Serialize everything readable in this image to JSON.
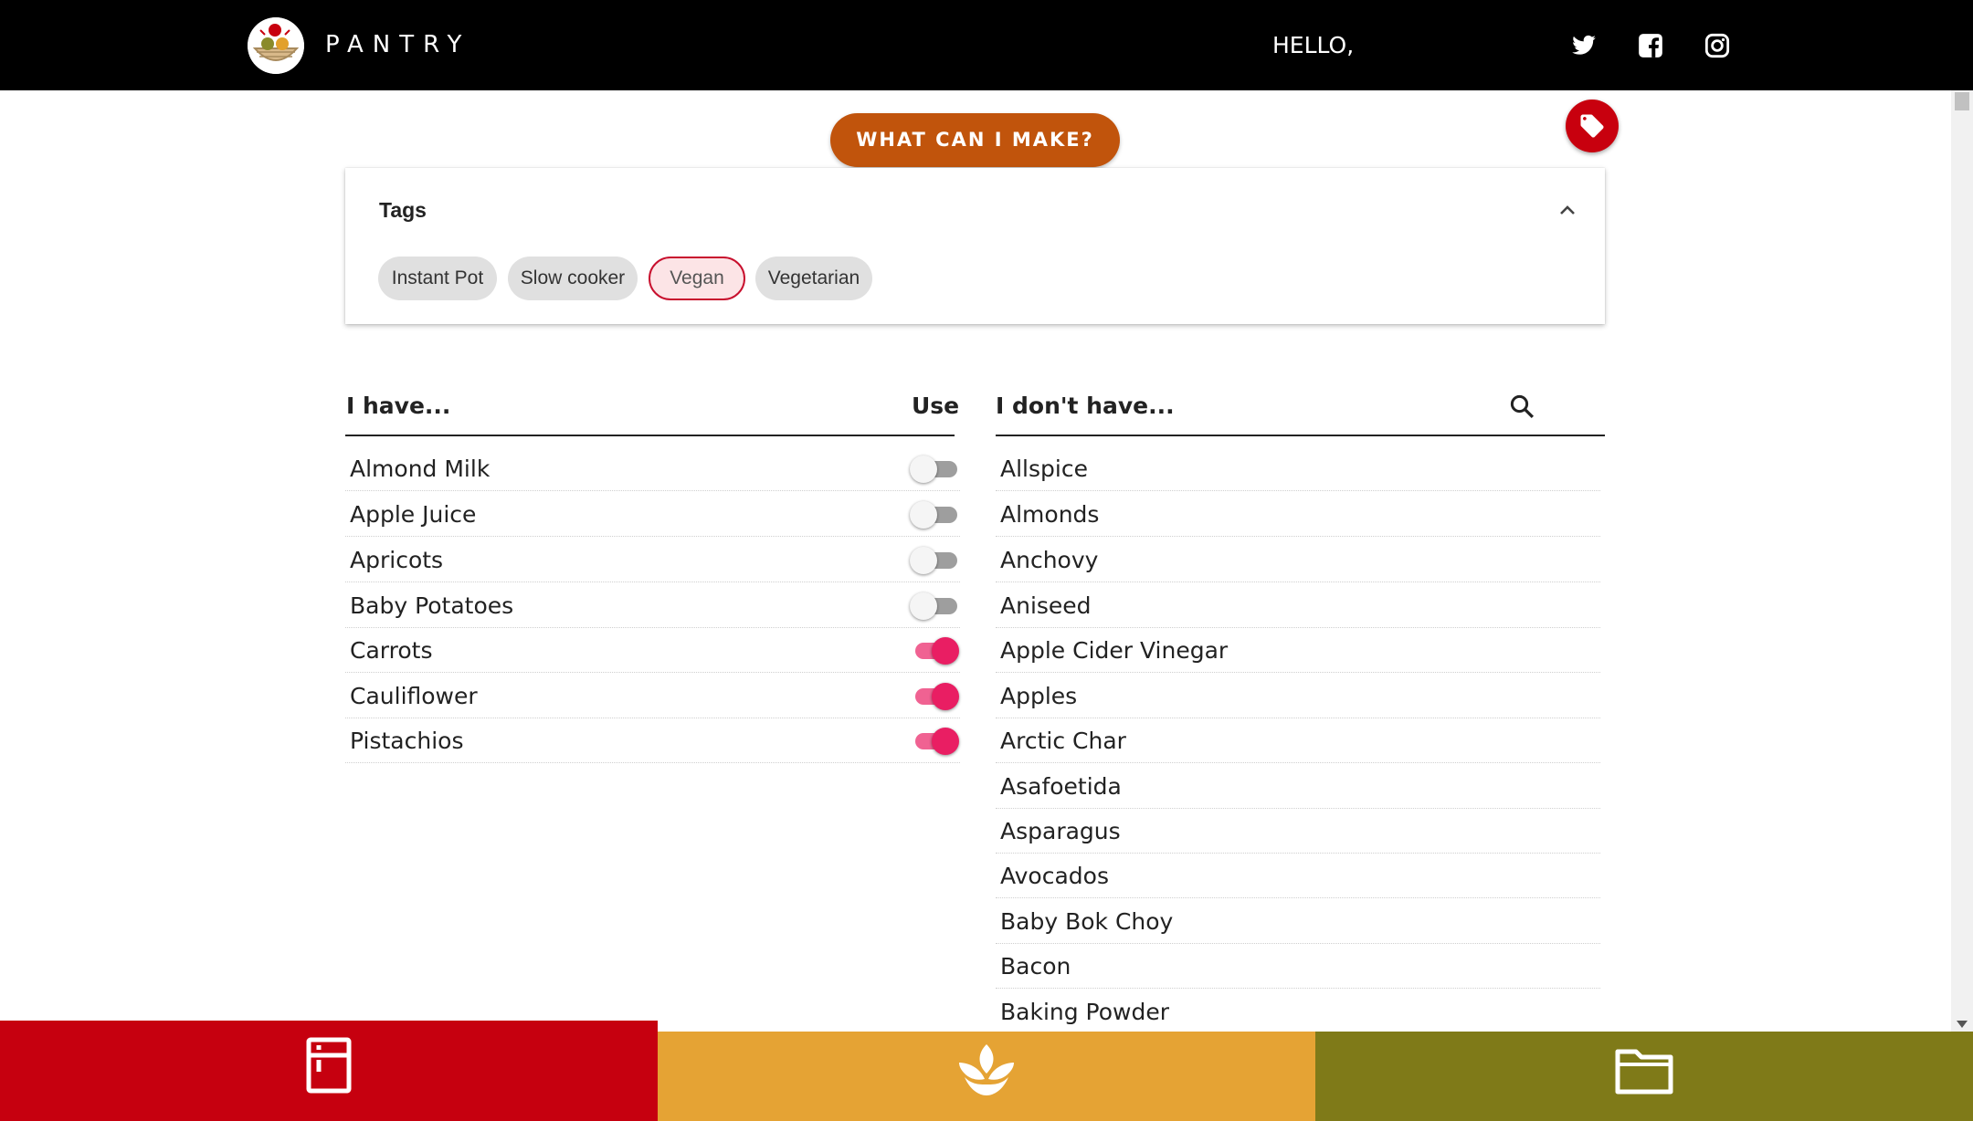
{
  "header": {
    "brand": "PANTRY",
    "greeting": "HELLO,",
    "social": [
      "twitter-icon",
      "facebook-icon",
      "instagram-icon"
    ],
    "colors": {
      "bar": "#000000"
    }
  },
  "actions": {
    "make_label": "WHAT CAN I MAKE?",
    "make_color": "#c1540c",
    "tag_button_icon": "tag-icon",
    "tag_button_color": "#c8000e"
  },
  "tags": {
    "title": "Tags",
    "chips": [
      {
        "label": "Instant Pot",
        "selected": false
      },
      {
        "label": "Slow cooker",
        "selected": false
      },
      {
        "label": "Vegan",
        "selected": true
      },
      {
        "label": "Vegetarian",
        "selected": false
      }
    ]
  },
  "have": {
    "title": "I have...",
    "use_label": "Use",
    "items": [
      {
        "name": "Almond Milk",
        "use": false
      },
      {
        "name": "Apple Juice",
        "use": false
      },
      {
        "name": "Apricots",
        "use": false
      },
      {
        "name": "Baby Potatoes",
        "use": false
      },
      {
        "name": "Carrots",
        "use": true
      },
      {
        "name": "Cauliflower",
        "use": true
      },
      {
        "name": "Pistachios",
        "use": true
      }
    ]
  },
  "dont_have": {
    "title": "I don't have...",
    "items": [
      "Allspice",
      "Almonds",
      "Anchovy",
      "Aniseed",
      "Apple Cider Vinegar",
      "Apples",
      "Arctic Char",
      "Asafoetida",
      "Asparagus",
      "Avocados",
      "Baby Bok Choy",
      "Bacon",
      "Baking Powder"
    ]
  },
  "bottom_nav": {
    "tabs": [
      {
        "icon": "fridge-icon",
        "color": "#c6000f"
      },
      {
        "icon": "plant-icon",
        "color": "#e5a334"
      },
      {
        "icon": "folder-icon",
        "color": "#7f7a18"
      }
    ]
  }
}
